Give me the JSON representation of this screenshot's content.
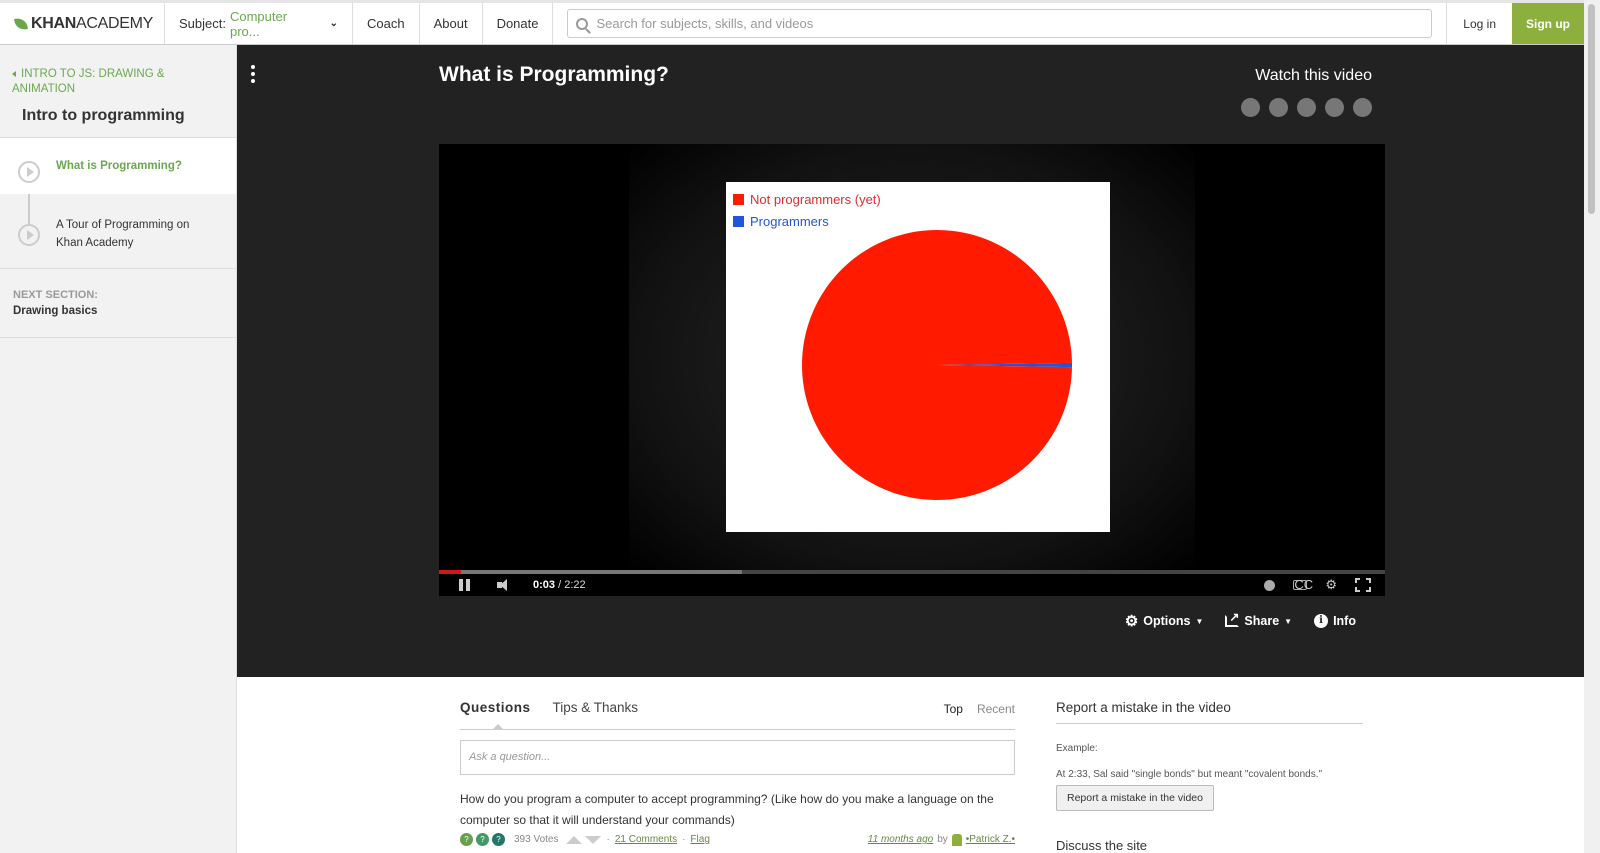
{
  "nav": {
    "logo_bold": "KHAN",
    "logo_light": "ACADEMY",
    "subject_label": "Subject:",
    "subject_value": "Computer pro...",
    "coach": "Coach",
    "about": "About",
    "donate": "Donate",
    "search_placeholder": "Search for subjects, skills, and videos",
    "login": "Log in",
    "signup": "Sign up"
  },
  "sidebar": {
    "breadcrumb": "INTRO TO JS: DRAWING & ANIMATION",
    "section_title": "Intro to programming",
    "tutorials": [
      {
        "label": "What is Programming?",
        "active": true
      },
      {
        "label": "A Tour of Programming on Khan Academy",
        "active": false
      }
    ],
    "next_section_heading": "NEXT SECTION:",
    "next_section_value": "Drawing basics"
  },
  "video": {
    "title": "What is Programming?",
    "watch_label": "Watch this video",
    "time_current": "0:03",
    "time_total": " / 2:22",
    "progress_played_fraction": 0.023,
    "progress_buffered_fraction": 0.32,
    "options_label": "Options",
    "share_label": "Share",
    "info_label": "Info"
  },
  "chart_data": {
    "type": "pie",
    "categories": [
      "Not programmers (yet)",
      "Programmers"
    ],
    "values": [
      99.5,
      0.5
    ],
    "colors": [
      "#ff1a00",
      "#2255dd"
    ],
    "legend_placement": "top-left"
  },
  "questions": {
    "tab_questions": "Questions",
    "tab_tips": "Tips & Thanks",
    "sort_top": "Top",
    "sort_recent": "Recent",
    "ask_placeholder": "Ask a question...",
    "question_text": "How do you program a computer to accept programming? (Like how do you make a language on the computer so that it will understand your commands)",
    "votes": "393 Votes",
    "comments": "21 Comments",
    "flag": "Flag",
    "ago": "11 months ago",
    "by": "by",
    "author": "•Patrick Z.•"
  },
  "report": {
    "heading": "Report a mistake in the video",
    "example_label": "Example:",
    "example_text": "At 2:33, Sal said \"single bonds\" but meant \"covalent bonds.\"",
    "button": "Report a mistake in the video",
    "discuss": "Discuss the site"
  }
}
